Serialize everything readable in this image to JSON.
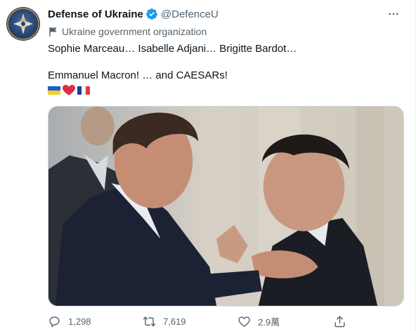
{
  "tweet": {
    "author": {
      "display_name": "Defense of Ukraine",
      "handle": "@DefenceU",
      "verified": true,
      "label": "Ukraine government organization",
      "avatar_icon": "ukraine-defense-emblem-icon"
    },
    "text": {
      "line1": "Sophie Marceau… Isabelle Adjani… Brigitte Bardot…",
      "line2": "Emmanuel Macron! …  and CAESARs!"
    },
    "emojis": [
      "ukraine-flag-icon",
      "red-heart-icon",
      "france-flag-icon"
    ],
    "media": {
      "icon": "photo-two-men-greeting"
    },
    "actions": {
      "reply_count": "1,298",
      "retweet_count": "7,619",
      "like_count": "2.9萬"
    }
  },
  "colors": {
    "verified_blue": "#1d9bf0",
    "text_primary": "#0f1419",
    "text_secondary": "#536471",
    "heart_red": "#dd2e44"
  }
}
